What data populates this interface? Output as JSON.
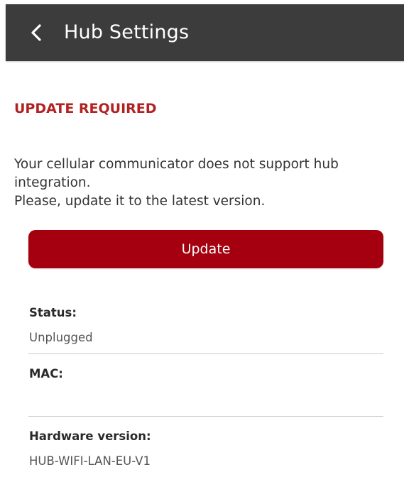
{
  "header": {
    "title": "Hub Settings",
    "back_icon": "chevron-left-icon"
  },
  "notice": {
    "heading": "UPDATE REQUIRED",
    "message_lines": [
      "Your cellular communicator does not support hub",
      "integration.",
      "Please, update it to the latest version."
    ]
  },
  "actions": {
    "update_label": "Update"
  },
  "details": {
    "status_label": "Status:",
    "status_value": "Unplugged",
    "mac_label": "MAC:",
    "mac_value": "",
    "hardware_label": "Hardware version:",
    "hardware_value": "HUB-WIFI-LAN-EU-V1"
  },
  "colors": {
    "appbar": "#3c3c3c",
    "accent_text": "#b22222",
    "button": "#a50010"
  }
}
